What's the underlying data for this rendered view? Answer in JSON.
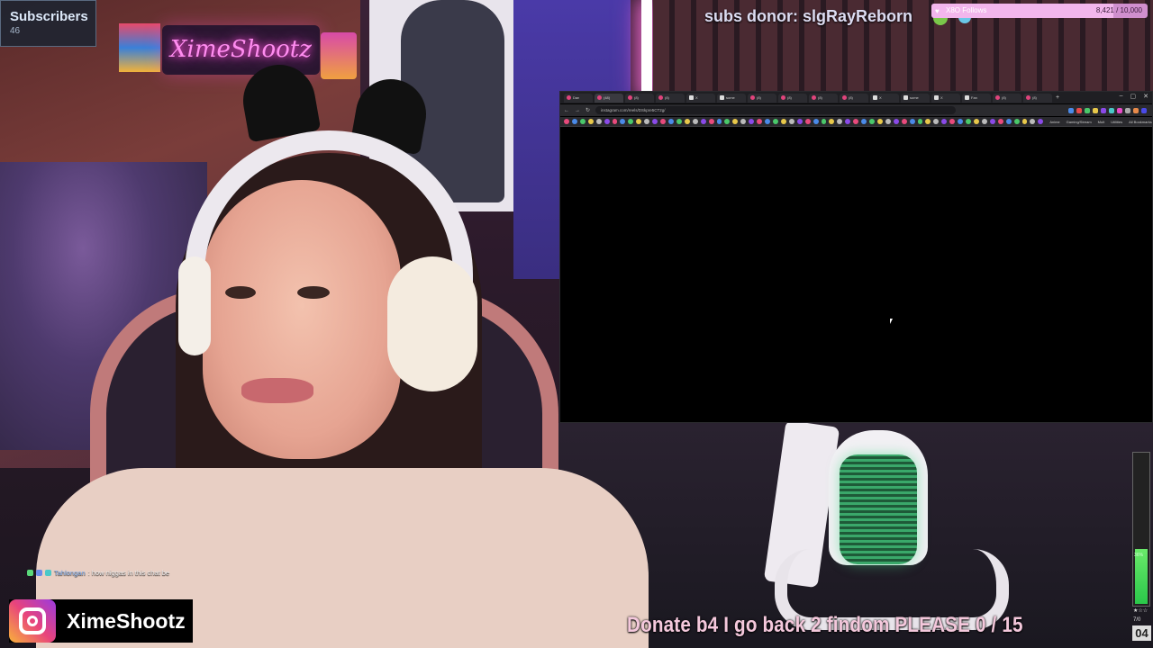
{
  "subscribers": {
    "title": "Subscribers",
    "count": "46"
  },
  "donor": {
    "text": "subs donor: slgRayReborn"
  },
  "follow_goal": {
    "label": "X8O Follows",
    "value": "8,421 / 10,000",
    "progress": 0.842,
    "fill_color": "#f2b6ec"
  },
  "neon_sign": {
    "text": "XimeShootz"
  },
  "browser": {
    "tabs": [
      {
        "icon": "instagram",
        "label": "Dan"
      },
      {
        "icon": "instagram",
        "label": "(48)"
      },
      {
        "icon": "instagram",
        "label": "(8)"
      },
      {
        "icon": "instagram",
        "label": "(8)"
      },
      {
        "icon": "x",
        "label": "X"
      },
      {
        "icon": "x",
        "label": "some"
      },
      {
        "icon": "instagram",
        "label": "(8)"
      },
      {
        "icon": "instagram",
        "label": "(8)"
      },
      {
        "icon": "instagram",
        "label": "(8)"
      },
      {
        "icon": "instagram",
        "label": "(8)"
      },
      {
        "icon": "x",
        "label": "X"
      },
      {
        "icon": "x",
        "label": "some"
      },
      {
        "icon": "x",
        "label": "X"
      },
      {
        "icon": "x",
        "label": "Fan"
      },
      {
        "icon": "instagram",
        "label": "(8)"
      },
      {
        "icon": "instagram",
        "label": "(8)"
      }
    ],
    "new_tab": "+",
    "window_controls": [
      "–",
      "▢",
      "✕"
    ],
    "url": "instagram.com/reels/DSkpre5CT2g/",
    "bookmark_folders": [
      "Anime",
      "Gaming/Stream",
      "Mult",
      "Utilities",
      "All Bookmarks"
    ]
  },
  "chat": {
    "user": "Tahlongan",
    "message": ": how niggas in this chat be"
  },
  "instagram": {
    "handle": "XimeShootz"
  },
  "donate_banner": {
    "text": "Donate b4 I go back 2 findom PLEASE  0 / 15"
  },
  "meter": {
    "percent_label": "36%",
    "stars": "★☆☆",
    "small_count": "7/0",
    "number": "04",
    "level": 0.36
  }
}
